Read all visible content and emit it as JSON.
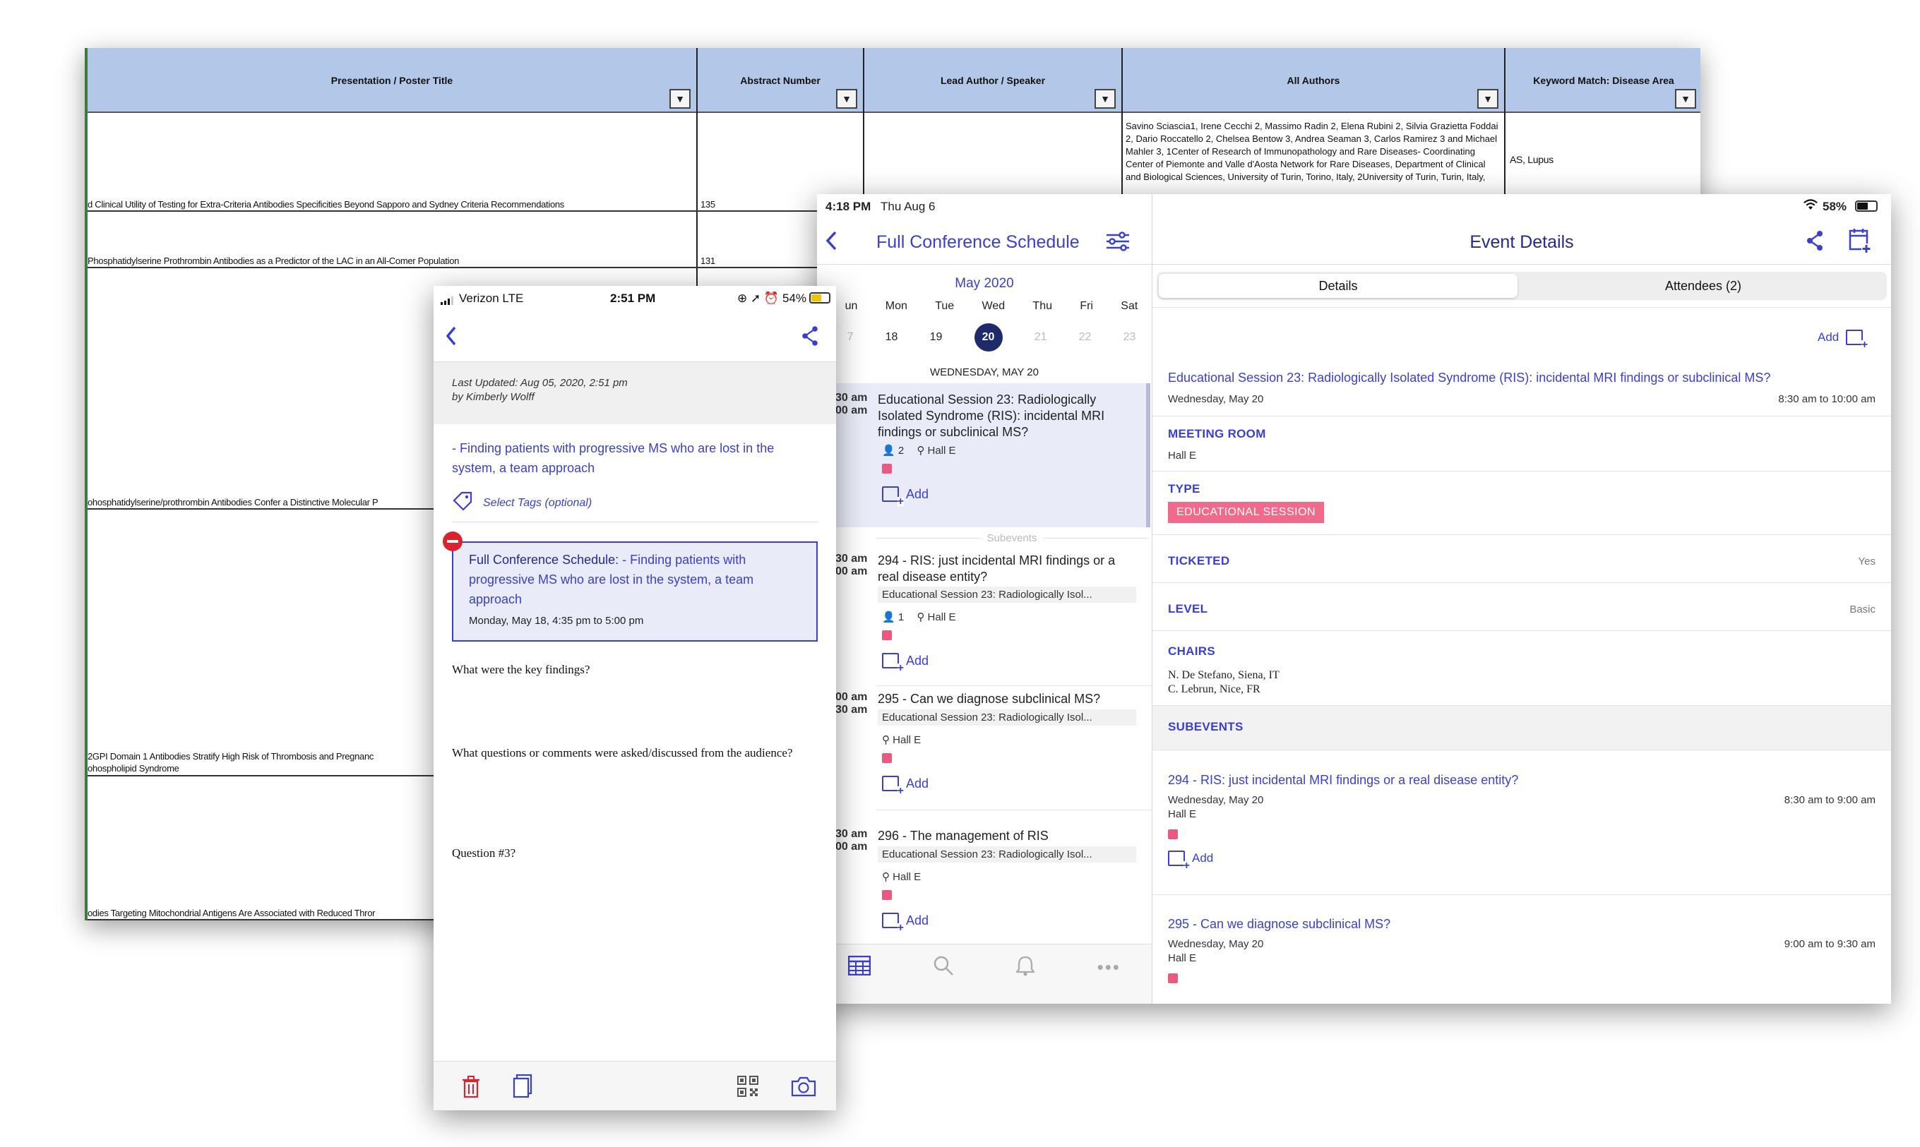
{
  "spreadsheet": {
    "headers": [
      "Presentation / Poster Title",
      "Abstract Number",
      "Lead Author / Speaker",
      "All Authors",
      "Keyword Match: Disease Area"
    ],
    "rows": [
      {
        "title": "d Clinical Utility of Testing for Extra-Criteria Antibodies Specificities Beyond Sapporo and Sydney Criteria Recommendations",
        "abstract": "135"
      },
      {
        "title": "Phosphatidylserine Prothrombin Antibodies as a Predictor of the LAC in an All-Comer Population",
        "abstract": "131"
      },
      {
        "title": "ohosphatidylserine/prothrombin Antibodies Confer a Distinctive Molecular P",
        "abstract": ""
      },
      {
        "title": "2GPI Domain 1 Antibodies Stratify High Risk of Thrombosis and Pregnanc",
        "title2": "ohospholipid Syndrome",
        "abstract": ""
      },
      {
        "title": "odies Targeting Mitochondrial Antigens Are Associated with Reduced Thror",
        "abstract": ""
      }
    ],
    "authors_cell": "Savino Sciascia1, Irene Cecchi 2, Massimo Radin 2, Elena Rubini 2, Silvia Grazietta Foddai 2, Dario Roccatello 2, Chelsea Bentow 3, Andrea Seaman 3, Carlos Ramirez 3 and Michael Mahler 3, 1Center of Research of Immunopathology and Rare Diseases- Coordinating Center of Piemonte and Valle d'Aosta Network for Rare Diseases, Department of Clinical and Biological Sciences, University of Turin, Torino, Italy, 2University of Turin, Turin, Italy,",
    "keyword_cell": "AS, Lupus",
    "filter_glyph": "▼"
  },
  "phone": {
    "status": {
      "carrier": "Verizon  LTE",
      "time": "2:51 PM",
      "battery": "54%"
    },
    "updated": {
      "line1": "Last Updated: Aug 05, 2020, 2:51 pm",
      "line2": "by Kimberly Wolff"
    },
    "note_title": "- Finding patients with progressive MS who are lost in the system, a team approach",
    "tags_placeholder": "Select Tags (optional)",
    "linked": {
      "prefix": "Full Conference Schedule:",
      "text": " - Finding patients with progressive MS who are lost in the system, a team approach",
      "date": "Monday, May 18, 4:35 pm to 5:00 pm"
    },
    "questions": [
      "What were the key findings?",
      "What questions or comments were asked/discussed from the audience?",
      "Question #3?"
    ],
    "icons": [
      "back-icon",
      "share-icon",
      "tag-icon",
      "trash-icon",
      "copy-icon",
      "qr-code-icon",
      "camera-icon"
    ],
    "accent_color": "#3b3fcf",
    "delete_color": "#d9232f"
  },
  "ipad": {
    "status": {
      "time": "4:18 PM",
      "date": "Thu Aug 6",
      "battery": "58%"
    },
    "schedule_title": "Full Conference Schedule",
    "month": "May 2020",
    "weekdays": [
      "un",
      "Mon",
      "Tue",
      "Wed",
      "Thu",
      "Fri",
      "Sat"
    ],
    "days": [
      "7",
      "18",
      "19",
      "20",
      "21",
      "22",
      "23"
    ],
    "selected_day": "20",
    "day_header": "WEDNESDAY, MAY 20",
    "subevents_label": "Subevents",
    "add_label": "Add",
    "sessions": [
      {
        "time1": "30 am",
        "time2": "00 am",
        "title": "Educational Session 23: Radiologically Isolated Syndrome (RIS): incidental MRI findings or subclinical MS?",
        "parent": "",
        "attendees": "2",
        "room": "Hall E"
      },
      {
        "time1": "30 am",
        "time2": "00 am",
        "title": "294 - RIS: just incidental MRI findings or a real disease entity?",
        "parent": "Educational Session 23: Radiologically Isol...",
        "attendees": "1",
        "room": "Hall E"
      },
      {
        "time1": "00 am",
        "time2": "30 am",
        "title": "295 - Can we diagnose subclinical MS?",
        "parent": "Educational Session 23: Radiologically Isol...",
        "attendees": "",
        "room": "Hall E"
      },
      {
        "time1": "30 am",
        "time2": "00 am",
        "title": "296 - The management of RIS",
        "parent": "Educational Session 23: Radiologically Isol...",
        "attendees": "",
        "room": "Hall E"
      }
    ],
    "tab_icons": [
      "calendar-icon",
      "search-icon",
      "bell-icon",
      "more-icon"
    ],
    "details": {
      "nav_title": "Event Details",
      "tabs": [
        "Details",
        "Attendees (2)"
      ],
      "event_title": "Educational Session 23: Radiologically Isolated Syndrome (RIS): incidental MRI findings or subclinical MS?",
      "event_date": "Wednesday, May 20",
      "event_time": "8:30 am to 10:00 am",
      "meeting_room_label": "MEETING ROOM",
      "meeting_room": "Hall E",
      "type_label": "TYPE",
      "type_value": "EDUCATIONAL SESSION",
      "ticketed_label": "TICKETED",
      "ticketed_value": "Yes",
      "level_label": "LEVEL",
      "level_value": "Basic",
      "chairs_label": "CHAIRS",
      "chairs": [
        "N. De Stefano, Siena, IT",
        "C. Lebrun, Nice, FR"
      ],
      "subevents_label": "SUBEVENTS",
      "subevents": [
        {
          "title": "294 - RIS: just incidental MRI findings or a real disease entity?",
          "date": "Wednesday, May 20",
          "time": "8:30 am to 9:00 am",
          "room": "Hall E"
        },
        {
          "title": "295 - Can we diagnose subclinical MS?",
          "date": "Wednesday, May 20",
          "time": "9:00 am to 9:30 am",
          "room": "Hall E"
        }
      ],
      "type_badge_color": "#ef6a8b",
      "accent_color": "#3b3fcf",
      "selected_day_color": "#1f2a6b"
    }
  }
}
